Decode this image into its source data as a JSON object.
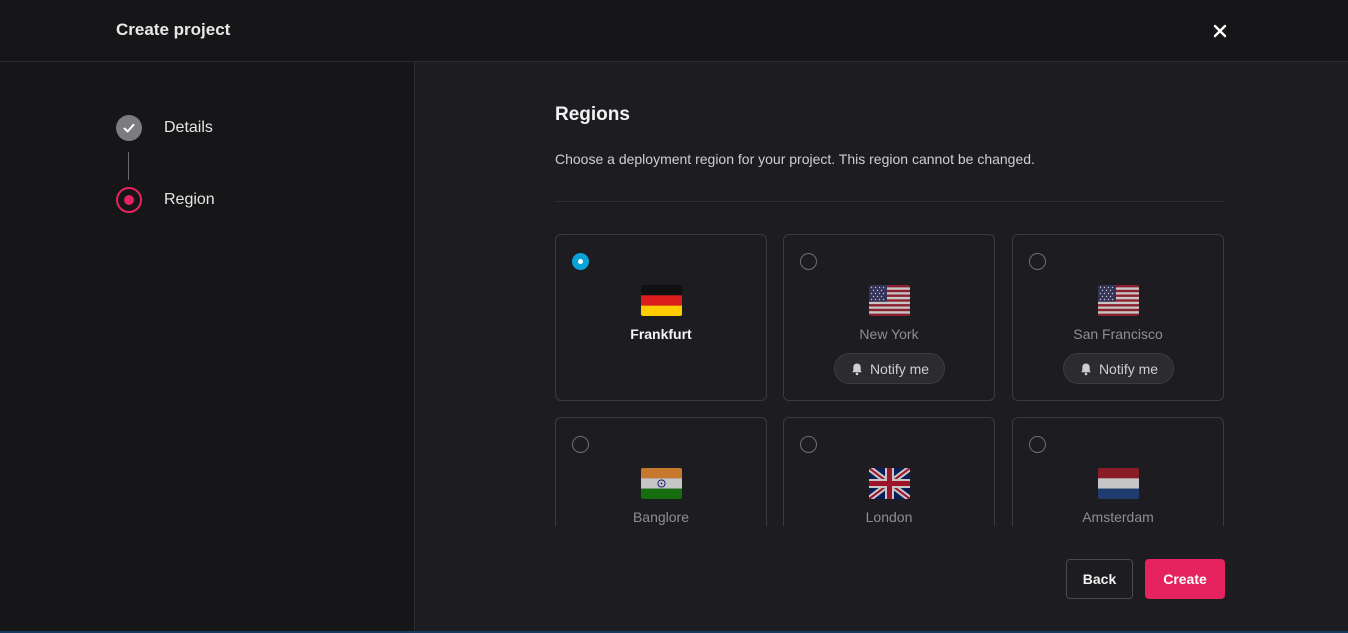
{
  "header": {
    "title": "Create project"
  },
  "steps": [
    {
      "label": "Details",
      "state": "done"
    },
    {
      "label": "Region",
      "state": "active"
    }
  ],
  "main": {
    "title": "Regions",
    "description": "Choose a deployment region for your project. This region cannot be changed."
  },
  "regions": [
    {
      "name": "Frankfurt",
      "flag": "germany-flag-icon",
      "selected": true,
      "notify_label": ""
    },
    {
      "name": "New York",
      "flag": "usa-flag-icon",
      "selected": false,
      "notify_label": "Notify me"
    },
    {
      "name": "San Francisco",
      "flag": "usa-flag-icon",
      "selected": false,
      "notify_label": "Notify me"
    },
    {
      "name": "Banglore",
      "flag": "india-flag-icon",
      "selected": false,
      "notify_label": ""
    },
    {
      "name": "London",
      "flag": "uk-flag-icon",
      "selected": false,
      "notify_label": ""
    },
    {
      "name": "Amsterdam",
      "flag": "netherlands-flag-icon",
      "selected": false,
      "notify_label": ""
    }
  ],
  "actions": {
    "back_label": "Back",
    "create_label": "Create"
  },
  "colors": {
    "accent": "#e5245f",
    "radio_selected": "#0aa3d9",
    "background": "#1d1d21",
    "sidebar": "#161618"
  }
}
